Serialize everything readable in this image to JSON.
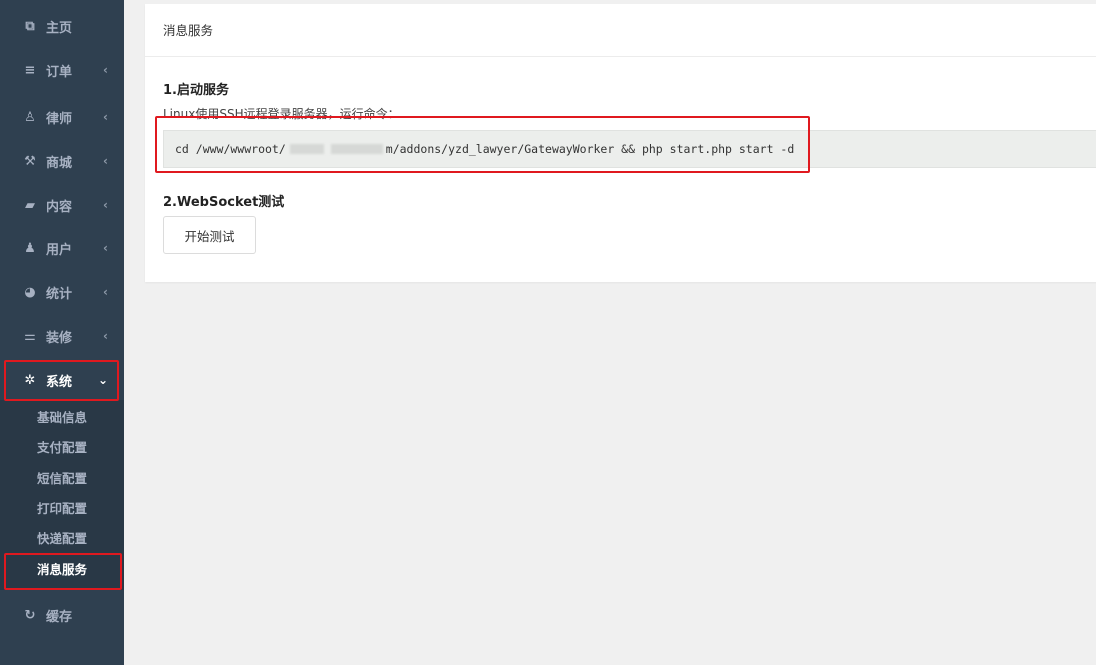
{
  "sidebar": {
    "items": [
      {
        "label": "主页",
        "icon": "copy-icon",
        "glyph": "⧉",
        "arrow": ""
      },
      {
        "label": "订单",
        "icon": "list-icon",
        "glyph": "≡",
        "arrow": "‹"
      },
      {
        "label": "律师",
        "icon": "user-icon",
        "glyph": "♙",
        "arrow": "‹"
      },
      {
        "label": "商城",
        "icon": "wrench-icon",
        "glyph": "⚒",
        "arrow": "‹"
      },
      {
        "label": "内容",
        "icon": "book-icon",
        "glyph": "▰",
        "arrow": "‹"
      },
      {
        "label": "用户",
        "icon": "person-icon",
        "glyph": "♟",
        "arrow": "‹"
      },
      {
        "label": "统计",
        "icon": "pie-chart-icon",
        "glyph": "◕",
        "arrow": "‹"
      },
      {
        "label": "装修",
        "icon": "tools-icon",
        "glyph": "⚌",
        "arrow": "‹"
      },
      {
        "label": "系统",
        "icon": "gear-icon",
        "glyph": "✲",
        "arrow": "⌄"
      },
      {
        "label": "缓存",
        "icon": "refresh-icon",
        "glyph": "↻",
        "arrow": ""
      }
    ],
    "submenu": [
      "基础信息",
      "支付配置",
      "短信配置",
      "打印配置",
      "快递配置",
      "消息服务"
    ]
  },
  "main": {
    "panel_title": "消息服务",
    "section1_title": "1.启动服务",
    "section1_desc": "Linux使用SSH远程登录服务器，运行命令：",
    "command_prefix": "cd /www/wwwroot/",
    "command_suffix": "m/addons/yzd_lawyer/GatewayWorker && php start.php start -d",
    "section2_title": "2.WebSocket测试",
    "test_button": "开始测试"
  },
  "colors": {
    "sidebar_bg": "#2f4050",
    "submenu_bg": "#293846",
    "highlight_border": "#e0191f",
    "code_bg": "#eceeec"
  }
}
